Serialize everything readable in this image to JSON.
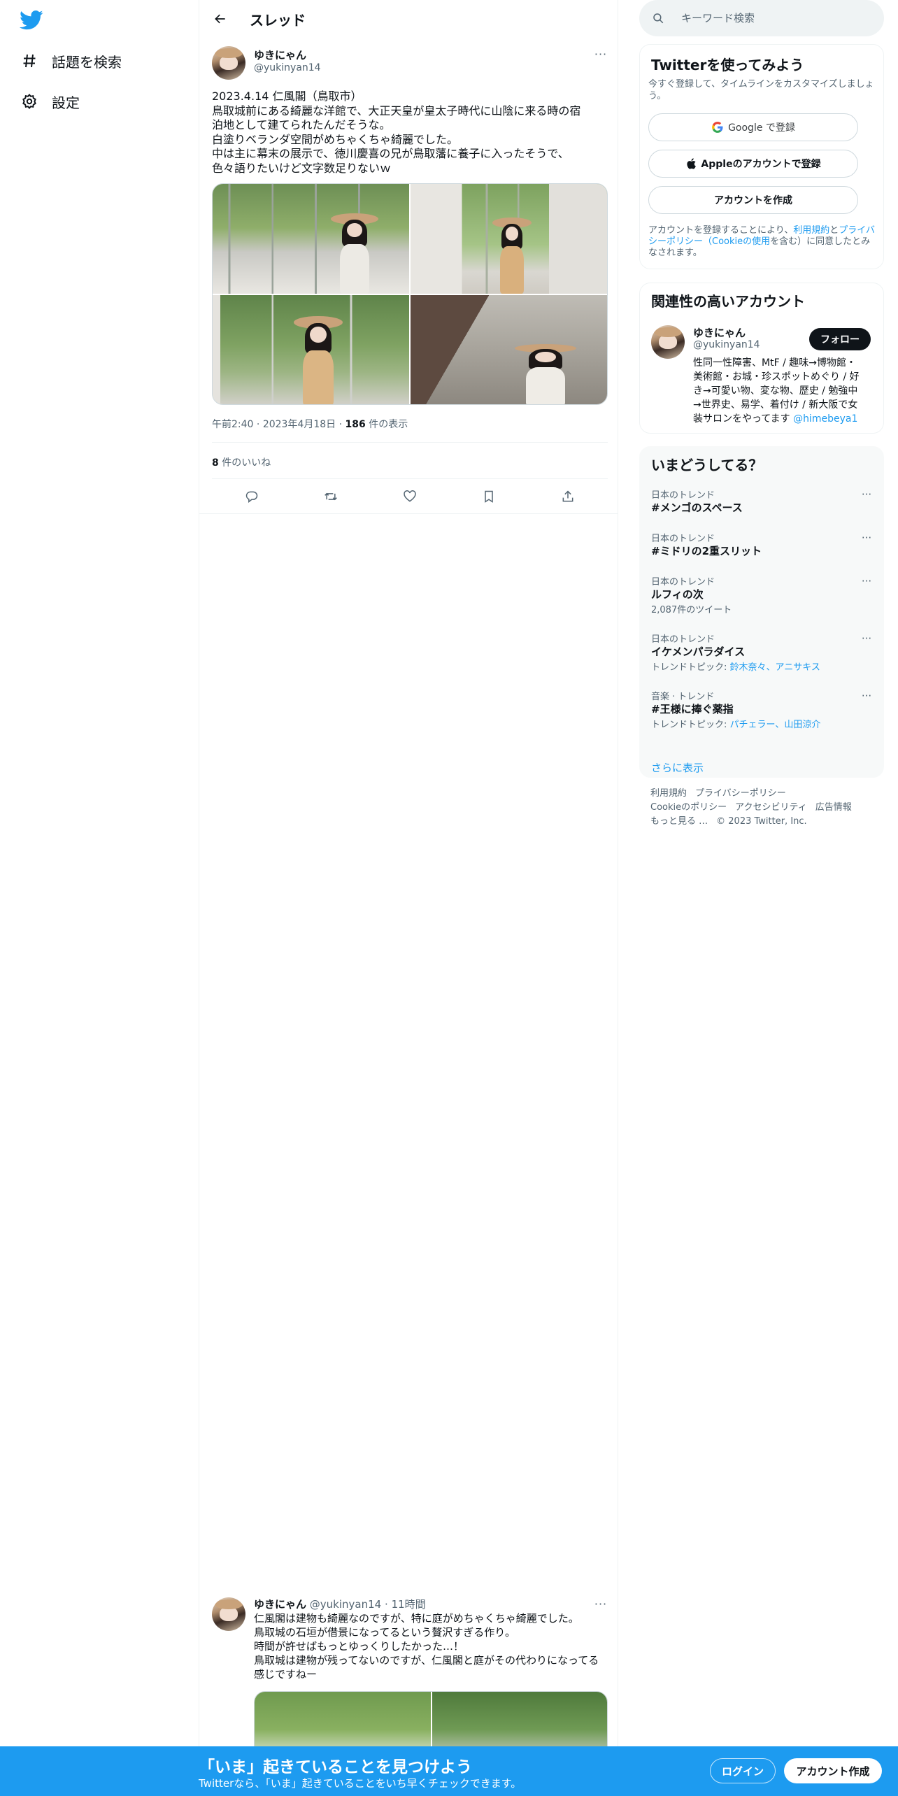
{
  "nav": {
    "logo_icon": "twitter-bird-icon",
    "items": [
      {
        "label": "話題を検索",
        "icon": "hashtag-icon"
      },
      {
        "label": "設定",
        "icon": "gear-icon"
      }
    ]
  },
  "header": {
    "back_icon": "arrow-left-icon",
    "title": "スレッド"
  },
  "tweet": {
    "name": "ゆきにゃん",
    "handle": "@yukinyan14",
    "more": "···",
    "text_lines": [
      "2023.4.14 仁風閣（鳥取市）",
      "鳥取城前にある綺麗な洋館で、大正天皇が皇太子時代に山陰に来る時の宿",
      "泊地として建てられたんだそうな。",
      "白塗りベランダ空間がめちゃくちゃ綺麗でした。",
      "中は主に幕末の展示で、徳川慶喜の兄が鳥取藩に養子に入ったそうで、",
      "色々語りたいけど文字数足りないｗ"
    ],
    "photo_count": 4,
    "meta": {
      "time": "午前2:40",
      "date": "2023年4月18日",
      "sep": "·",
      "views": "186",
      "views_suffix": "件の表示"
    },
    "likes": {
      "count": "8",
      "suffix": "件のいいね"
    },
    "actions": [
      "reply-icon",
      "retweet-icon",
      "like-icon",
      "bookmark-icon",
      "share-icon"
    ]
  },
  "reply": {
    "name": "ゆきにゃん",
    "handle": "@yukinyan14",
    "sep": "·",
    "time": "11時間",
    "more": "···",
    "text_lines": [
      "仁風閣は建物も綺麗なのですが、特に庭がめちゃくちゃ綺麗でした。",
      "鳥取城の石垣が借景になってるという贅沢すぎる作り。",
      "時間が許せばもっとゆっくりしたかった…！",
      "鳥取城は建物が残ってないのですが、仁風閣と庭がその代わりになってる",
      "感じですねー"
    ],
    "photo_count": 2
  },
  "search": {
    "placeholder": "キーワード検索",
    "icon": "search-icon"
  },
  "signup_card": {
    "title": "Twitterを使ってみよう",
    "subtitle": "今すぐ登録して、タイムラインをカスタマイズしましょう。",
    "google_button": "Google で登録",
    "apple_button": "Appleのアカウントで登録",
    "create_button": "アカウントを作成",
    "legal_prefix": "アカウントを登録することにより、",
    "legal_terms": "利用規約",
    "legal_and": "と",
    "legal_privacy": "プライバシーポリシー",
    "legal_paren_open": "（",
    "legal_cookie": "Cookieの使用",
    "legal_suffix": "を含む）に同意したとみなされます。"
  },
  "related": {
    "title": "関連性の高いアカウント",
    "name": "ゆきにゃん",
    "handle": "@yukinyan14",
    "follow_label": "フォロー",
    "bio_lines": [
      "性同一性障害、MtF / 趣味→博物館・",
      "美術館・お城・珍スポットめぐり / 好",
      "き→可愛い物、変な物、歴史 / 勉強中",
      "→世界史、易学、着付け / 新大阪で女"
    ],
    "bio_last_prefix": "装サロンをやってます ",
    "bio_mention": "@himebeya1"
  },
  "trends": {
    "title": "いまどうしてる？",
    "items": [
      {
        "context": "日本のトレンド",
        "name": "#メンゴのスペース"
      },
      {
        "context": "日本のトレンド",
        "name": "#ミドリの2重スリット"
      },
      {
        "context": "日本のトレンド",
        "name": "ルフィの次",
        "sub": "2,087件のツイート"
      },
      {
        "context": "日本のトレンド",
        "name": "イケメンパラダイス",
        "sub_prefix": "トレンドトピック: ",
        "sub_links": "鈴木奈々、アニサキス"
      },
      {
        "context": "音楽 · トレンド",
        "name": "#王様に捧ぐ薬指",
        "sub_prefix": "トレンドトピック: ",
        "sub_links": "パチェラー、山田涼介"
      }
    ],
    "more_icon": "···",
    "show_more": "さらに表示"
  },
  "footer": {
    "line1": [
      "利用規約",
      "プライバシーポリシー"
    ],
    "line2": [
      "Cookieのポリシー",
      "アクセシビリティ",
      "広告情報"
    ],
    "more": "もっと見る …",
    "copyright": "© 2023 Twitter, Inc."
  },
  "banner": {
    "title": "「いま」起きていることを見つけよう",
    "subtitle": "Twitterなら、「いま」起きていることをいち早くチェックできます。",
    "login": "ログイン",
    "signup": "アカウント作成"
  },
  "colors": {
    "accent": "#1d9bf0",
    "text": "#0f1419",
    "secondary": "#536471",
    "border": "#eff3f4"
  }
}
